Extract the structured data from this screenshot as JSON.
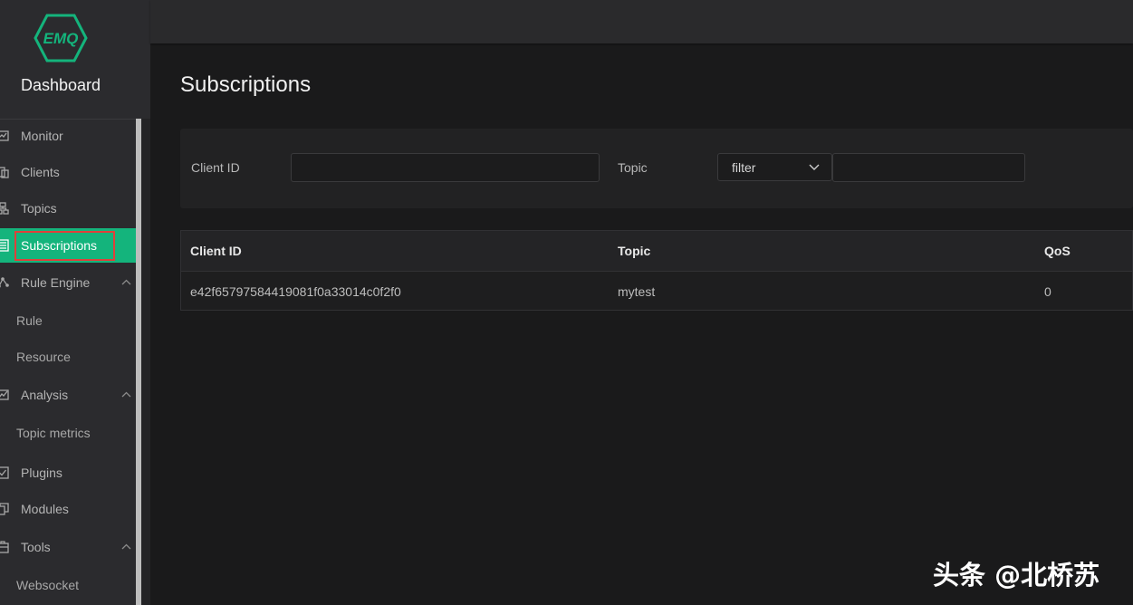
{
  "app": {
    "logo_text": "EMQ",
    "title": "Dashboard"
  },
  "sidebar": {
    "items": [
      {
        "label": "Monitor"
      },
      {
        "label": "Clients"
      },
      {
        "label": "Topics"
      },
      {
        "label": "Subscriptions",
        "active": true
      },
      {
        "label": "Rule Engine",
        "expanded": true
      },
      {
        "label": "Rule"
      },
      {
        "label": "Resource"
      },
      {
        "label": "Analysis",
        "expanded": true
      },
      {
        "label": "Topic metrics"
      },
      {
        "label": "Plugins"
      },
      {
        "label": "Modules"
      },
      {
        "label": "Tools",
        "expanded": true
      },
      {
        "label": "Websocket"
      }
    ]
  },
  "page": {
    "title": "Subscriptions"
  },
  "filter": {
    "client_id_label": "Client ID",
    "client_id_value": "",
    "topic_label": "Topic",
    "topic_match": "filter",
    "topic_value": ""
  },
  "table": {
    "columns": [
      "Client ID",
      "Topic",
      "QoS"
    ],
    "rows": [
      [
        "e42f65797584419081f0a33014c0f2f0",
        "mytest",
        "0"
      ]
    ]
  },
  "watermark": "头条 @北桥苏",
  "colors": {
    "accent": "#14b47c",
    "highlight_outline": "#e0403a",
    "background": "#1a1a1b",
    "sidebar": "#2b2b2e"
  }
}
